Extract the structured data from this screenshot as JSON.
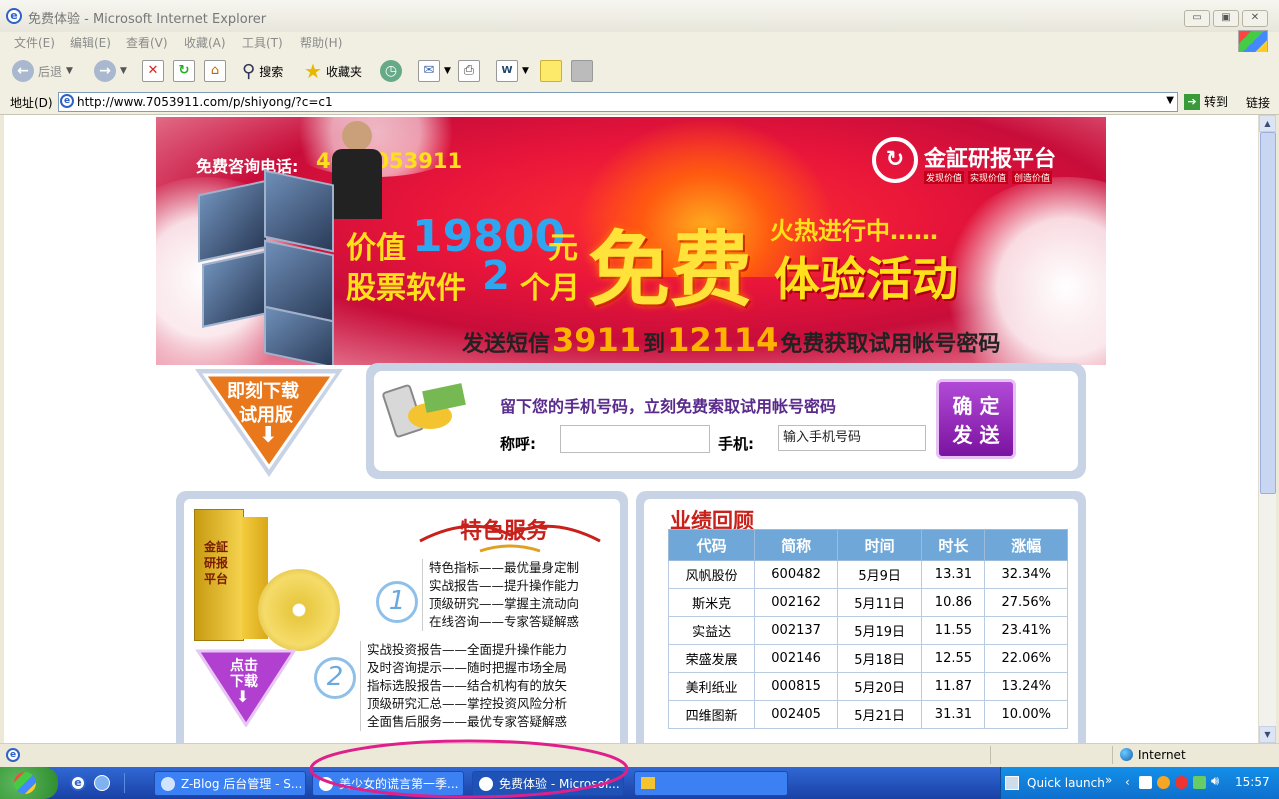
{
  "window": {
    "title": "免费体验 - Microsoft Internet Explorer",
    "min": "▭",
    "max": "▣",
    "close": "✕"
  },
  "menu": [
    "文件(E)",
    "编辑(E)",
    "查看(V)",
    "收藏(A)",
    "工具(T)",
    "帮助(H)"
  ],
  "toolbar": {
    "back": "后退",
    "search": "搜索",
    "favorites": "收藏夹"
  },
  "address": {
    "label": "地址(D)",
    "url": "http://www.7053911.com/p/shiyong/?c=c1",
    "go": "转到",
    "links": "链接"
  },
  "banner": {
    "hotline_label": "免费咨询电话:",
    "hotline_number": "4007053911",
    "brand": "金証研报平台",
    "slogans": [
      "发现价值",
      "实现价值",
      "创造价值"
    ],
    "value_prefix": "价值",
    "value_amount": "19800",
    "value_unit": "元",
    "software_prefix": "股票软件",
    "software_months": "2",
    "software_unit": "个月",
    "free": "免费",
    "hot": "火热进行中……",
    "activity": "体验活动",
    "sms_a": "发送短信",
    "sms_code": "3911",
    "sms_to": "到",
    "sms_num": "12114",
    "sms_b": "免费获取试用帐号密码"
  },
  "trial": {
    "download_line1": "即刻下载",
    "download_line2": "试用版",
    "prompt": "留下您的手机号码，立刻免费索取试用帐号密码",
    "name_label": "称呼:",
    "name_value": "",
    "phone_label": "手机:",
    "phone_value": "输入手机号码",
    "submit_line1": "确 定",
    "submit_line2": "发 送"
  },
  "services": {
    "heading": "特色服务",
    "num1": "1",
    "list1": [
      "特色指标——最优量身定制",
      "实战报告——提升操作能力",
      "顶级研究——掌握主流动向",
      "在线咨询——专家答疑解惑"
    ],
    "num2": "2",
    "list2": [
      "实战投资报告——全面提升操作能力",
      "及时咨询提示——随时把握市场全局",
      "指标选股报告——结合机构有的放矢",
      "顶级研究汇总——掌控投资风险分析",
      "全面售后服务——最优专家答疑解惑"
    ],
    "download_line1": "点击",
    "download_line2": "下载",
    "box_brand": "金証研报平台"
  },
  "performance": {
    "heading": "业绩回顾",
    "columns": [
      "代码",
      "简称",
      "时间",
      "时长",
      "涨幅"
    ],
    "rows": [
      [
        "风帆股份",
        "600482",
        "5月9日",
        "13.31",
        "32.34%"
      ],
      [
        "斯米克",
        "002162",
        "5月11日",
        "10.86",
        "27.56%"
      ],
      [
        "实益达",
        "002137",
        "5月19日",
        "11.55",
        "23.41%"
      ],
      [
        "荣盛发展",
        "002146",
        "5月18日",
        "12.55",
        "22.06%"
      ],
      [
        "美利纸业",
        "000815",
        "5月20日",
        "11.87",
        "13.24%"
      ],
      [
        "四维图新",
        "002405",
        "5月21日",
        "31.31",
        "10.00%"
      ]
    ]
  },
  "status": {
    "zone": "Internet"
  },
  "taskbar": {
    "tasks": [
      "Z-Blog 后台管理 - S...",
      "美少女的谎言第一季...",
      "免费体验 - Microsof...",
      ""
    ],
    "quick_launch": "Quick launch",
    "time": "15:57"
  },
  "colors": {
    "banner_red": "#e8153a",
    "accent_yellow": "#ffe01a",
    "table_header": "#6fa7d8",
    "purple_button": "#8e1fb5",
    "annotation_pink": "#e0208a"
  }
}
